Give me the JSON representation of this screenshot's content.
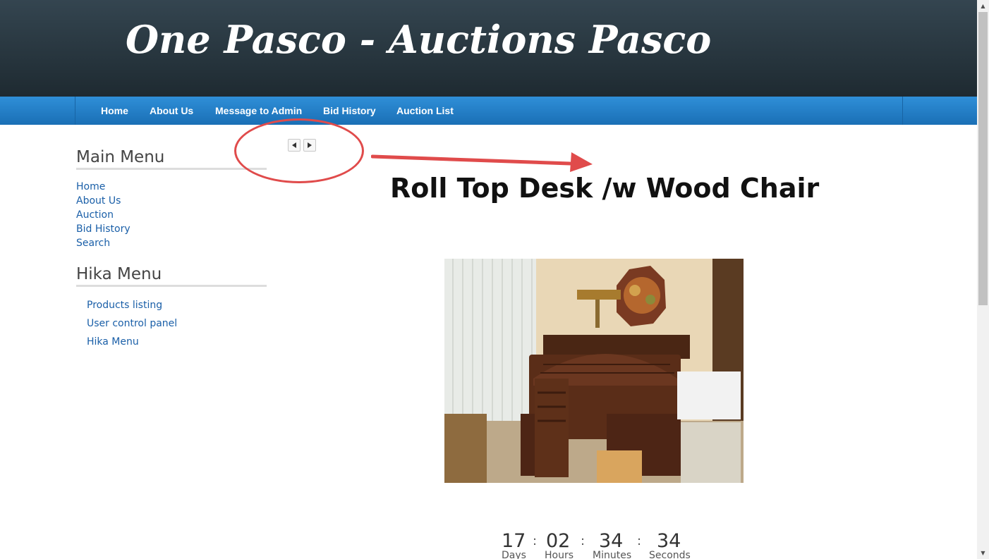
{
  "header": {
    "site_title": "One Pasco - Auctions Pasco"
  },
  "nav": {
    "items": [
      {
        "label": "Home"
      },
      {
        "label": "About Us"
      },
      {
        "label": "Message to Admin"
      },
      {
        "label": "Bid History"
      },
      {
        "label": "Auction List"
      }
    ]
  },
  "sidebar": {
    "main_menu": {
      "heading": "Main Menu",
      "items": [
        {
          "label": "Home"
        },
        {
          "label": "About Us"
        },
        {
          "label": "Auction"
        },
        {
          "label": "Bid History"
        },
        {
          "label": "Search"
        }
      ]
    },
    "hika_menu": {
      "heading": "Hika Menu",
      "items": [
        {
          "label": "Products listing"
        },
        {
          "label": "User control panel"
        },
        {
          "label": "Hika Menu"
        }
      ]
    }
  },
  "pager": {
    "prev_icon": "triangle-left",
    "next_icon": "triangle-right"
  },
  "product": {
    "title": "Roll Top Desk /w Wood Chair"
  },
  "countdown": {
    "days": "17",
    "hours": "02",
    "minutes": "34",
    "seconds": "34",
    "separator": ":",
    "days_label": "Days",
    "hours_label": "Hours",
    "minutes_label": "Minutes",
    "seconds_label": "Seconds"
  },
  "colors": {
    "link": "#1a5fa8",
    "nav_bar": "#2384cc",
    "annotation": "#e04b4b",
    "header_bg": "#2b3940"
  }
}
